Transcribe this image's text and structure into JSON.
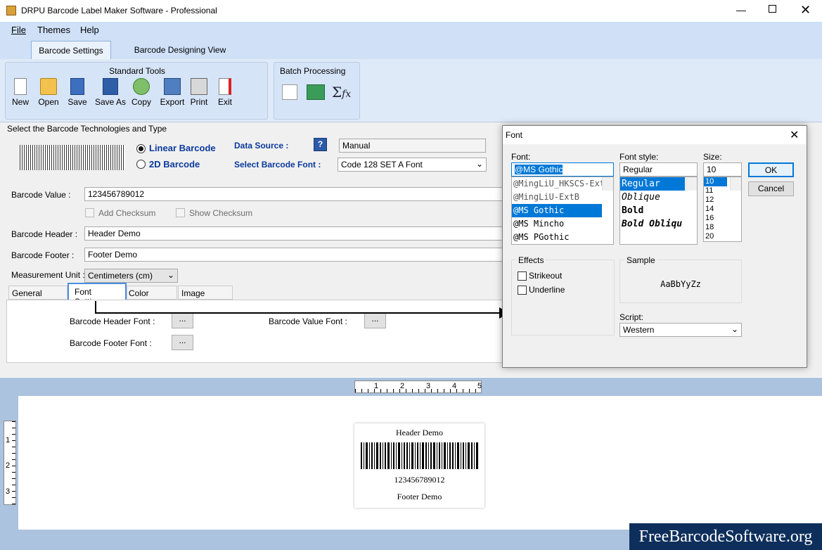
{
  "window": {
    "title": "DRPU Barcode Label Maker Software - Professional"
  },
  "menu": [
    "File",
    "Themes",
    "Help"
  ],
  "main_tabs": {
    "barcode_settings": "Barcode Settings",
    "designing_view": "Barcode Designing View"
  },
  "ribbon": {
    "standard_title": "Standard Tools",
    "tools": [
      "New",
      "Open",
      "Save",
      "Save As",
      "Copy",
      "Export",
      "Print",
      "Exit"
    ],
    "batch_title": "Batch Processing"
  },
  "tech": {
    "section_title": "Select the Barcode Technologies and Type",
    "linear": "Linear Barcode",
    "twod": "2D Barcode",
    "data_source_label": "Data Source :",
    "data_source_value": "Manual",
    "font_label": "Select Barcode Font :",
    "font_value": "Code 128 SET A Font"
  },
  "form": {
    "barcode_value_label": "Barcode Value :",
    "barcode_value": "123456789012",
    "add_checksum": "Add Checksum",
    "show_checksum": "Show Checksum",
    "header_label": "Barcode Header :",
    "header_value": "Header Demo",
    "footer_label": "Barcode Footer :",
    "footer_value": "Footer Demo",
    "unit_label": "Measurement Unit :",
    "unit_value": "Centimeters (cm)"
  },
  "subtabs": [
    "General Settings",
    "Font Settings",
    "Color Settings",
    "Image Settings"
  ],
  "font_settings": {
    "header_font": "Barcode Header Font :",
    "footer_font": "Barcode Footer Font :",
    "value_font": "Barcode Value Font :",
    "browse": "..."
  },
  "font_dialog": {
    "title": "Font",
    "font_label": "Font:",
    "font_value": "@MS Gothic",
    "fonts": [
      "@MingLiU_HKSCS-Ext",
      "@MingLiU-ExtB",
      "@MS Gothic",
      "@MS Mincho",
      "@MS PGothic"
    ],
    "style_label": "Font style:",
    "style_value": "Regular",
    "styles": [
      "Regular",
      "Oblique",
      "Bold",
      "Bold Obliqu"
    ],
    "size_label": "Size:",
    "size_value": "10",
    "sizes": [
      "10",
      "11",
      "12",
      "14",
      "16",
      "18",
      "20"
    ],
    "ok": "OK",
    "cancel": "Cancel",
    "effects_title": "Effects",
    "strikeout": "Strikeout",
    "underline": "Underline",
    "sample_title": "Sample",
    "sample_text": "AaBbYyZz",
    "script_label": "Script:",
    "script_value": "Western"
  },
  "canvas": {
    "ruler_top": [
      "1",
      "2",
      "3",
      "4",
      "5"
    ],
    "ruler_left": [
      "1",
      "2",
      "3"
    ],
    "label_header": "Header Demo",
    "label_value": "123456789012",
    "label_footer": "Footer Demo"
  },
  "watermark": "FreeBarcodeSoftware.org",
  "colors": {
    "accent": "#0078d7",
    "ribbon": "#cfe0f7",
    "link_blue": "#0b3a9c"
  }
}
